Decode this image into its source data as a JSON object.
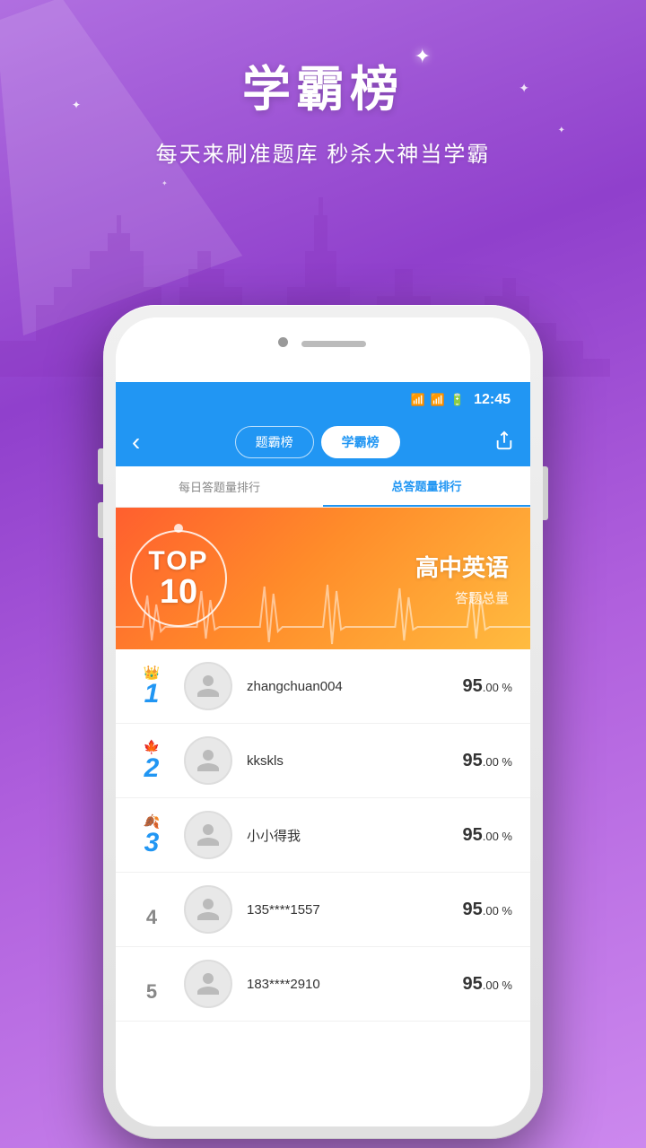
{
  "background": {
    "gradient_start": "#b06fe0",
    "gradient_end": "#d4a0f0"
  },
  "header": {
    "title": "学霸榜",
    "star_symbol": "✦",
    "subtitle": "每天来刷准题库 秒杀大神当学霸"
  },
  "status_bar": {
    "time": "12:45",
    "icons": [
      "signal",
      "battery"
    ]
  },
  "nav": {
    "back_icon": "‹",
    "tab1_label": "题霸榜",
    "tab2_label": "学霸榜",
    "share_icon": "⬆"
  },
  "sub_tabs": {
    "tab1_label": "每日答题量排行",
    "tab2_label": "总答题量排行"
  },
  "banner": {
    "top_label": "TOP",
    "top_number": "10",
    "category": "高中英语",
    "subcategory": "答题总量"
  },
  "leaderboard": [
    {
      "rank": "1",
      "rank_class": "rank-1",
      "crown": "👑",
      "name": "zhangchuan004",
      "score_big": "95",
      "score_suffix": ".00",
      "score_unit": "%"
    },
    {
      "rank": "2",
      "rank_class": "rank-2",
      "crown": "🍁",
      "name": "kkskls",
      "score_big": "95",
      "score_suffix": ".00",
      "score_unit": "%"
    },
    {
      "rank": "3",
      "rank_class": "rank-3",
      "crown": "🍂",
      "name": "小小得我",
      "score_big": "95",
      "score_suffix": ".00",
      "score_unit": "%"
    },
    {
      "rank": "4",
      "rank_class": "rank-4",
      "crown": "",
      "name": "135****1557",
      "score_big": "95",
      "score_suffix": ".00",
      "score_unit": "%"
    },
    {
      "rank": "5",
      "rank_class": "rank-5",
      "crown": "",
      "name": "183****2910",
      "score_big": "95",
      "score_suffix": ".00",
      "score_unit": "%"
    }
  ]
}
